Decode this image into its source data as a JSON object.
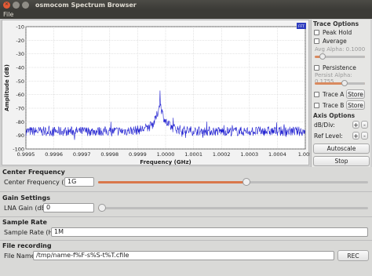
{
  "window": {
    "title": "osmocom Spectrum Browser"
  },
  "menu": {
    "file": "File"
  },
  "plot": {
    "badge": "FFT"
  },
  "chart_data": {
    "type": "line",
    "xlabel": "Frequency (GHz)",
    "ylabel": "Amplitude (dB)",
    "x_ticks": [
      "0.9995",
      "0.9996",
      "0.9997",
      "0.9998",
      "0.9999",
      "1.0000",
      "1.0001",
      "1.0002",
      "1.0003",
      "1.0004",
      "1.005"
    ],
    "y_ticks": [
      "-10",
      "-20",
      "-30",
      "-40",
      "-50",
      "-60",
      "-70",
      "-80",
      "-90",
      "-100"
    ],
    "xlim": [
      0.9995,
      1.0005
    ],
    "ylim": [
      -100,
      -10
    ],
    "grid": true,
    "noise_floor_db": -87,
    "peak": {
      "x": 0.99998,
      "y": -57
    },
    "color": "#1f1fd0"
  },
  "side": {
    "trace_options": "Trace Options",
    "peak_hold": "Peak Hold",
    "average": "Average",
    "avg_alpha": "Avg Alpha: 0.1000",
    "avg_alpha_value": 0.1,
    "persistence": "Persistence",
    "persist_alpha": "Persist Alpha: 0.1755",
    "persist_alpha_value": 0.6,
    "trace_a": "Trace A",
    "trace_b": "Trace B",
    "store": "Store",
    "axis_options": "Axis Options",
    "db_div": "dB/Div:",
    "ref_level": "Ref Level:",
    "plus": "+",
    "minus": "-",
    "autoscale": "Autoscale",
    "stop": "Stop"
  },
  "center_frequency": {
    "section": "Center Frequency",
    "label": "Center Frequency (Hz):",
    "value": "1G",
    "slider_fraction": 0.55
  },
  "gain": {
    "section": "Gain Settings",
    "label": "LNA Gain (dB):",
    "value": "0",
    "slider_fraction": 0.0
  },
  "sample_rate": {
    "section": "Sample Rate",
    "label": "Sample Rate (Hz):",
    "value": "1M"
  },
  "recording": {
    "section": "File recording",
    "label": "File Name:",
    "value": "/tmp/name-f%F-s%S-t%T.cfile",
    "rec": "REC"
  }
}
